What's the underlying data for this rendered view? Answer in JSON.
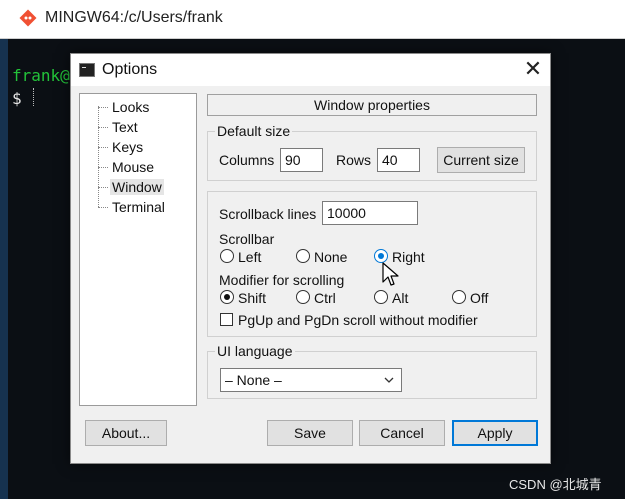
{
  "terminal": {
    "title": "MINGW64:/c/Users/frank",
    "prompt_user": "frank@",
    "prompt_symbol": "$"
  },
  "dialog": {
    "title": "Options",
    "close_glyph": "✕",
    "tree": [
      "Looks",
      "Text",
      "Keys",
      "Mouse",
      "Window",
      "Terminal"
    ],
    "selected_tree_item": "Window",
    "section_title": "Window properties",
    "default_size": {
      "legend": "Default size",
      "columns_label": "Columns",
      "columns_value": "90",
      "rows_label": "Rows",
      "rows_value": "40",
      "current_size_button": "Current size"
    },
    "scroll": {
      "scrollback_label": "Scrollback lines",
      "scrollback_value": "10000",
      "scrollbar_label": "Scrollbar",
      "scrollbar_options": [
        "Left",
        "None",
        "Right"
      ],
      "scrollbar_selected": "Right",
      "modifier_label": "Modifier for scrolling",
      "modifier_options": [
        "Shift",
        "Ctrl",
        "Alt",
        "Off"
      ],
      "modifier_selected": "Shift",
      "pgup_checkbox_label": "PgUp and PgDn scroll without modifier",
      "pgup_checked": false
    },
    "ui_language": {
      "legend": "UI language",
      "selected": "– None –"
    },
    "buttons": {
      "about": "About...",
      "save": "Save",
      "cancel": "Cancel",
      "apply": "Apply"
    }
  },
  "watermark": "CSDN @北城青",
  "colors": {
    "accent": "#0078d7",
    "prompt_green": "#23c33a",
    "terminal_bg": "#0b0f14"
  }
}
